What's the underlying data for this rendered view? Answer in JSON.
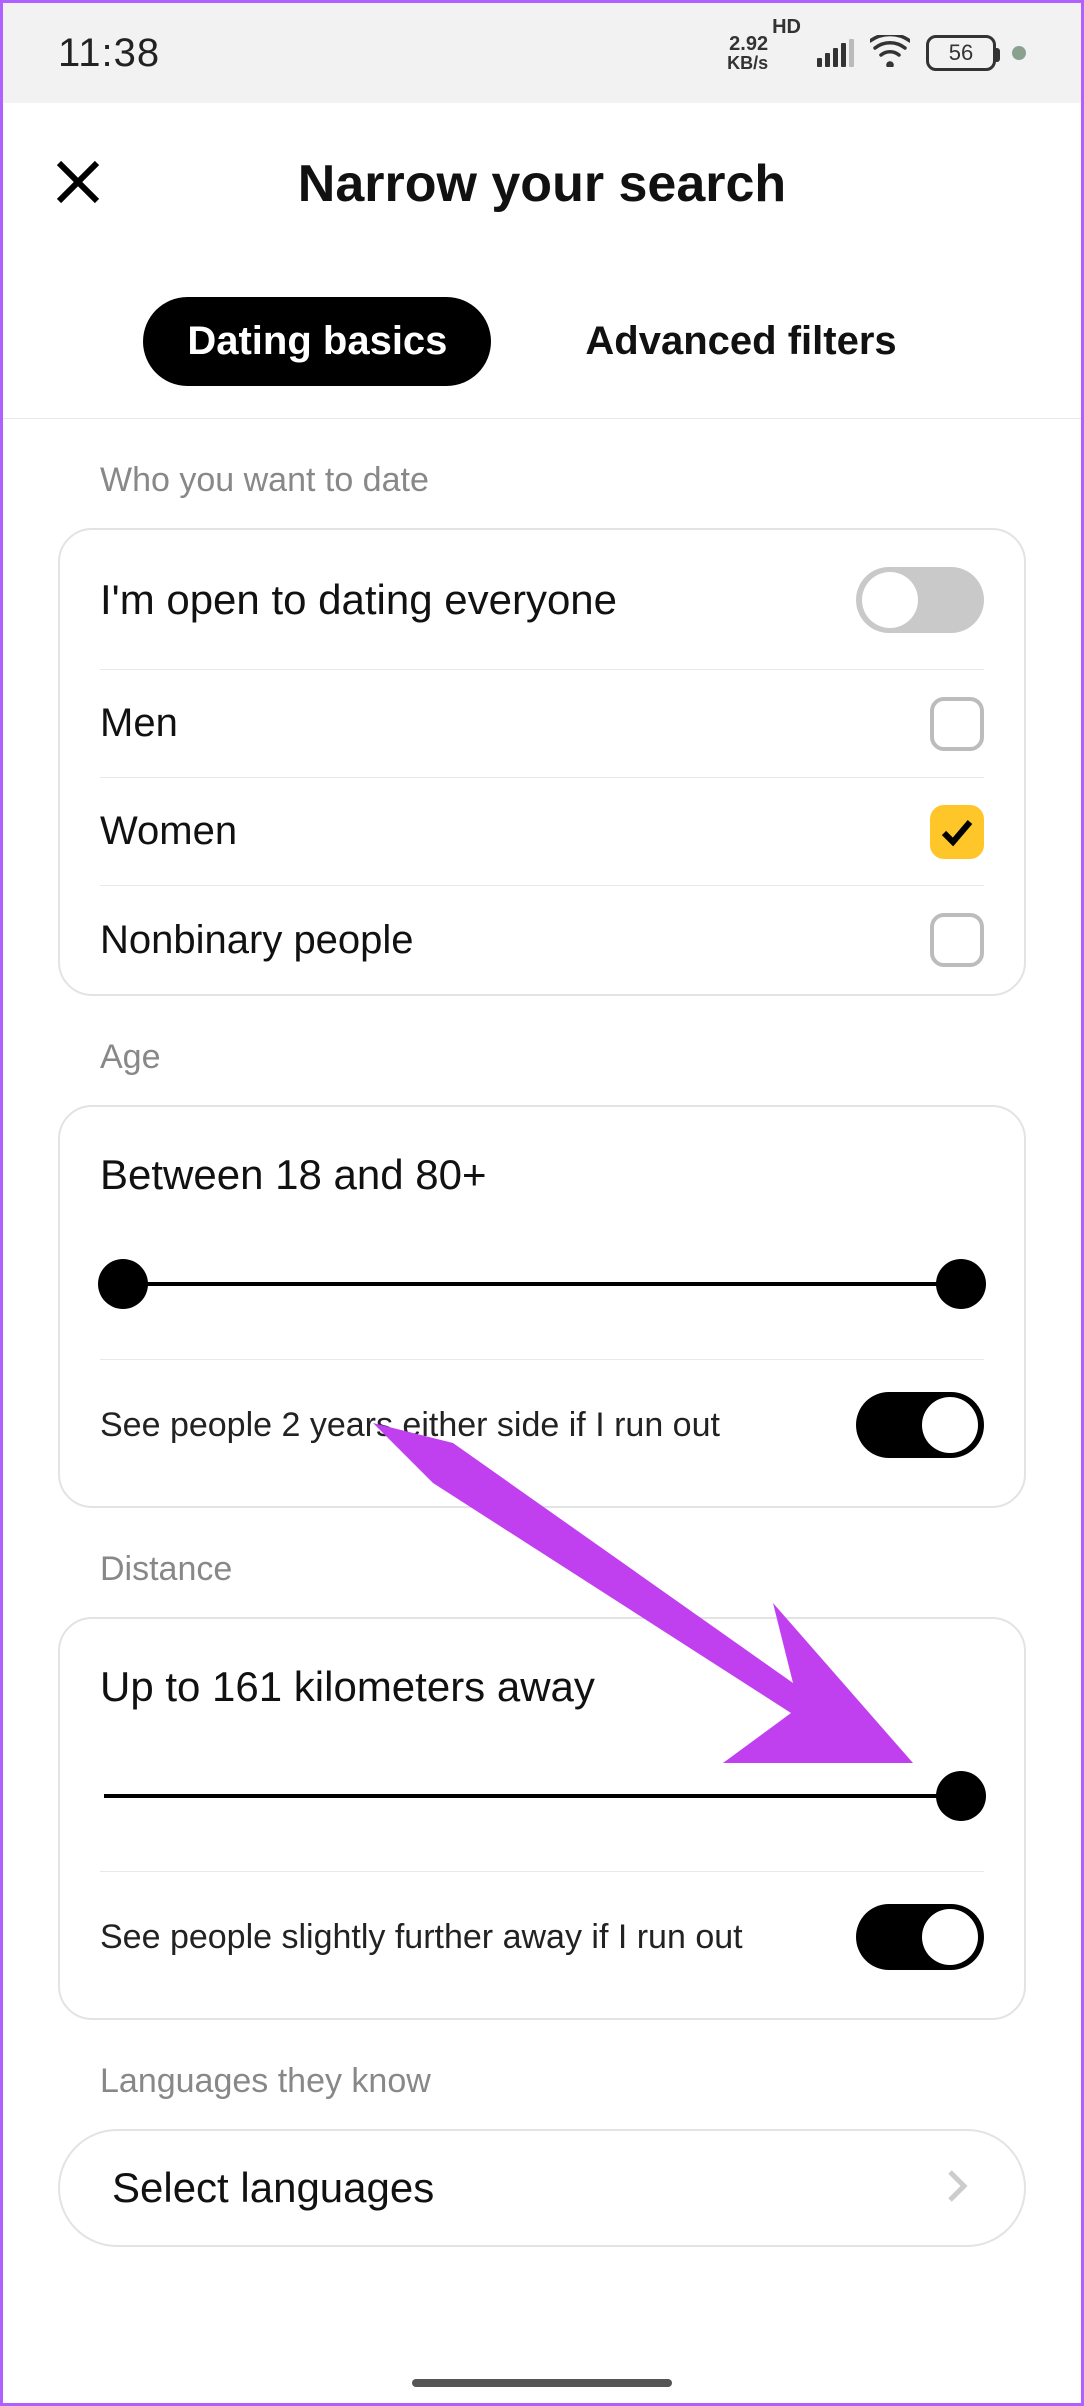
{
  "statusbar": {
    "time": "11:38",
    "net_speed": "2.92",
    "net_unit": "KB/s",
    "hd": "HD",
    "battery_pct": "56"
  },
  "header": {
    "title": "Narrow your search"
  },
  "tabs": {
    "basics": "Dating basics",
    "advanced": "Advanced filters"
  },
  "who": {
    "section": "Who you want to date",
    "open": "I'm open to dating everyone",
    "men": "Men",
    "women": "Women",
    "nonbinary": "Nonbinary people"
  },
  "age": {
    "section": "Age",
    "title": "Between 18 and 80+",
    "extend": "See people 2 years either side if I run out"
  },
  "distance": {
    "section": "Distance",
    "title": "Up to 161 kilometers away",
    "extend": "See people slightly further away if I run out"
  },
  "languages": {
    "section": "Languages they know",
    "select": "Select languages"
  }
}
